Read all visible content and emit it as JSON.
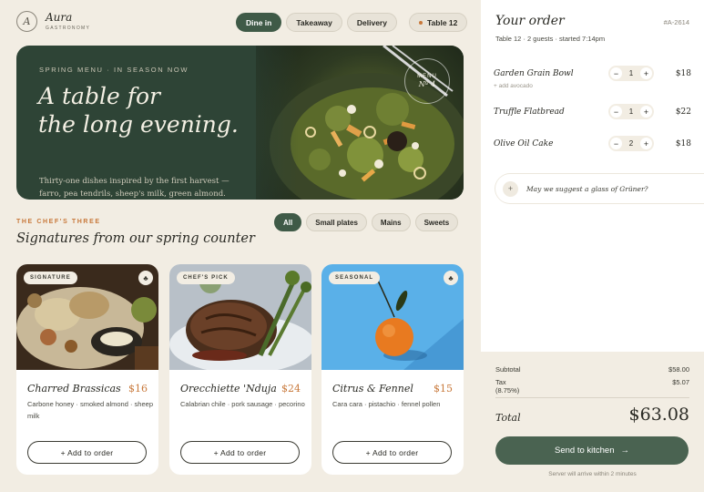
{
  "brand": {
    "mark": "A",
    "name": "Aura",
    "sub": "GASTRONOMY"
  },
  "header": {
    "modes": [
      {
        "label": "Dine in",
        "active": true
      },
      {
        "label": "Takeaway",
        "active": false
      },
      {
        "label": "Delivery",
        "active": false
      }
    ],
    "table": "Table 12"
  },
  "hero": {
    "kicker": "SPRING MENU · IN SEASON NOW",
    "title_line1": "A table for",
    "title_line2": "the long evening.",
    "description": "Thirty-one dishes inspired by the first harvest — farro, pea tendrils, sheep's milk, green almond.",
    "badge_top": "MENU",
    "badge_bottom": "Nº 4"
  },
  "section": {
    "kicker": "THE CHEF'S THREE",
    "title": "Signatures from our spring counter",
    "filters": [
      {
        "label": "All",
        "active": true
      },
      {
        "label": "Small plates",
        "active": false
      },
      {
        "label": "Mains",
        "active": false
      },
      {
        "label": "Sweets",
        "active": false
      }
    ]
  },
  "cards": [
    {
      "tag": "SIGNATURE",
      "name": "Charred Brassicas",
      "price": "$16",
      "description": "Carbone honey · smoked almond · sheep milk",
      "button": "+ Add to order",
      "image": "roasted-brassicas-photo"
    },
    {
      "tag": "CHEF'S PICK",
      "name": "Orecchiette 'Nduja",
      "price": "$24",
      "description": "Calabrian chile · pork sausage · pecorino",
      "button": "+ Add to order",
      "image": "steak-photo"
    },
    {
      "tag": "SEASONAL",
      "name": "Citrus & Fennel",
      "price": "$15",
      "description": "Cara cara · pistachio · fennel pollen",
      "button": "+ Add to order",
      "image": "mandarin-photo"
    }
  ],
  "order": {
    "title": "Your order",
    "id": "#A-2614",
    "meta": "Table 12 · 2 guests · started 7:14pm",
    "items": [
      {
        "name": "Garden Grain Bowl",
        "note": "+ add avocado",
        "qty": "1",
        "price": "$18"
      },
      {
        "name": "Truffle Flatbread",
        "note": "",
        "qty": "1",
        "price": "$22"
      },
      {
        "name": "Olive Oil Cake",
        "note": "",
        "qty": "2",
        "price": "$18"
      }
    ],
    "suggestion": "May we suggest a glass of Grüner?",
    "subtotal_label": "Subtotal",
    "subtotal": "$58.00",
    "tax_label": "Tax",
    "tax_rate": "(8.75%)",
    "tax": "$5.07",
    "total_label": "Total",
    "total": "$63.08",
    "send_label": "Send to kitchen",
    "note": "Server will arrive within 2 minutes"
  },
  "colors": {
    "accent": "#3f5a47",
    "price": "#c8783a",
    "background": "#f2ede3"
  }
}
